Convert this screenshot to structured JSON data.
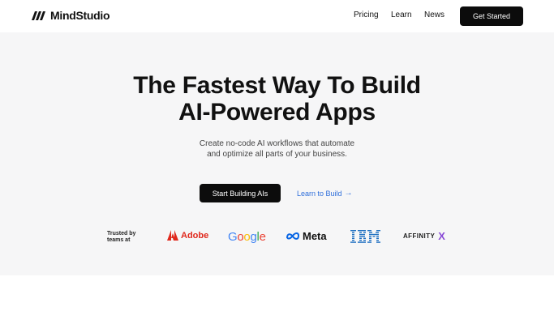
{
  "nav": {
    "brand": "MindStudio",
    "links": [
      "Pricing",
      "Learn",
      "News"
    ],
    "cta": "Get Started"
  },
  "hero": {
    "headline_line1": "The Fastest Way To Build",
    "headline_line2": "AI-Powered Apps",
    "subtext_line1": "Create no-code AI workflows that automate",
    "subtext_line2": "and optimize all parts of your business.",
    "primary_cta": "Start Building AIs",
    "secondary_cta": "Learn to Build",
    "secondary_cta_icon": "arrow-right-icon"
  },
  "trusted": {
    "label_line1": "Trusted by",
    "label_line2": "teams at",
    "brands": [
      "Adobe",
      "Google",
      "Meta",
      "IBM",
      "AFFINITY"
    ],
    "affinity_suffix": "X"
  },
  "colors": {
    "primary_button": "#0c0c0c",
    "link": "#2f6fdb",
    "hero_bg": "#f6f6f7",
    "adobe_red": "#e0281c"
  }
}
